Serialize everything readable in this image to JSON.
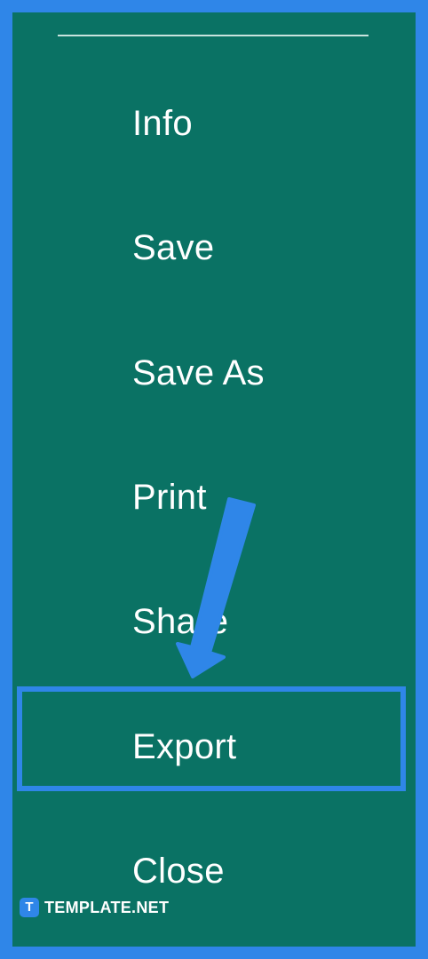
{
  "menu": {
    "items": [
      {
        "label": "Info"
      },
      {
        "label": "Save"
      },
      {
        "label": "Save As"
      },
      {
        "label": "Print"
      },
      {
        "label": "Share"
      },
      {
        "label": "Export"
      },
      {
        "label": "Close"
      }
    ],
    "highlighted": "Export"
  },
  "annotation": {
    "arrow_icon": "arrow-down-icon",
    "highlight_color": "#2f86e8"
  },
  "colors": {
    "panel_background": "#0a7264",
    "frame": "#2f86e8",
    "text": "#ffffff"
  },
  "watermark": {
    "logo_letter": "T",
    "text": "TEMPLATE.NET"
  }
}
